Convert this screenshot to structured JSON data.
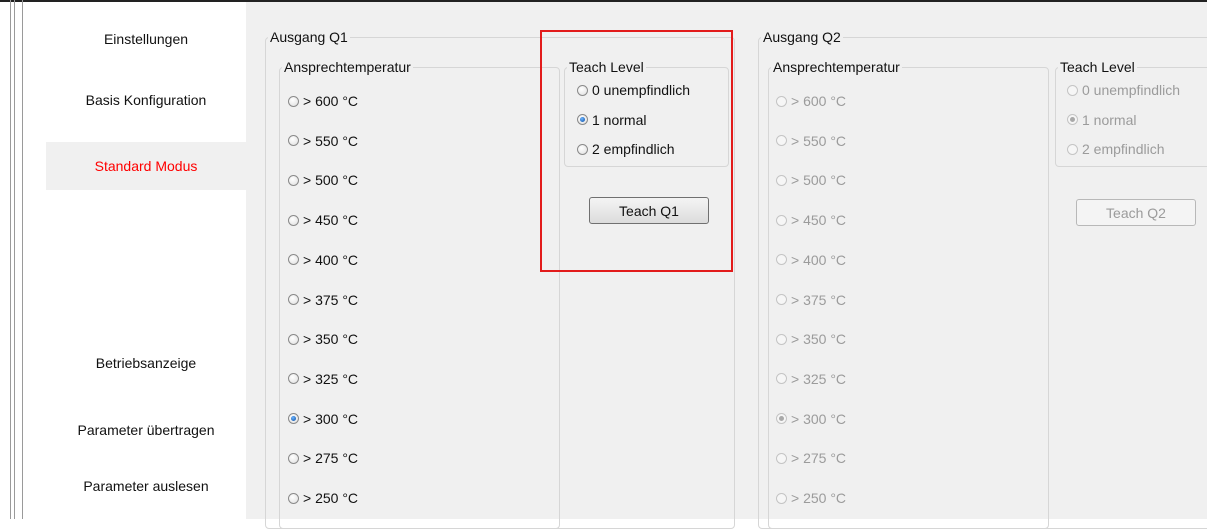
{
  "sidebar": {
    "items": [
      {
        "label": "Einstellungen"
      },
      {
        "label": "Basis Konfiguration"
      },
      {
        "label": "Standard Modus"
      },
      {
        "label": "Betriebsanzeige"
      },
      {
        "label": "Parameter übertragen"
      },
      {
        "label": "Parameter auslesen"
      }
    ],
    "active_index": 2,
    "active_color": "#ff0000"
  },
  "q1": {
    "title": "Ausgang Q1",
    "temp_title": "Ansprechtemperatur",
    "temps": [
      "> 600 °C",
      "> 550 °C",
      "> 500 °C",
      "> 450 °C",
      "> 400 °C",
      "> 375 °C",
      "> 350 °C",
      "> 325 °C",
      "> 300 °C",
      "> 275 °C",
      "> 250 °C"
    ],
    "temp_selected": "> 300 °C",
    "teach_title": "Teach Level",
    "teach_levels": [
      "0 unempfindlich",
      "1 normal",
      "2 empfindlich"
    ],
    "teach_selected": "1 normal",
    "button": "Teach Q1",
    "enabled": true
  },
  "q2": {
    "title": "Ausgang Q2",
    "temp_title": "Ansprechtemperatur",
    "temps": [
      "> 600 °C",
      "> 550 °C",
      "> 500 °C",
      "> 450 °C",
      "> 400 °C",
      "> 375 °C",
      "> 350 °C",
      "> 325 °C",
      "> 300 °C",
      "> 275 °C",
      "> 250 °C"
    ],
    "temp_selected": "> 300 °C",
    "teach_title": "Teach Level",
    "teach_levels": [
      "0 unempfindlich",
      "1 normal",
      "2 empfindlich"
    ],
    "teach_selected": "1 normal",
    "button": "Teach Q2",
    "enabled": false
  },
  "highlight_color": "#e21b1b"
}
